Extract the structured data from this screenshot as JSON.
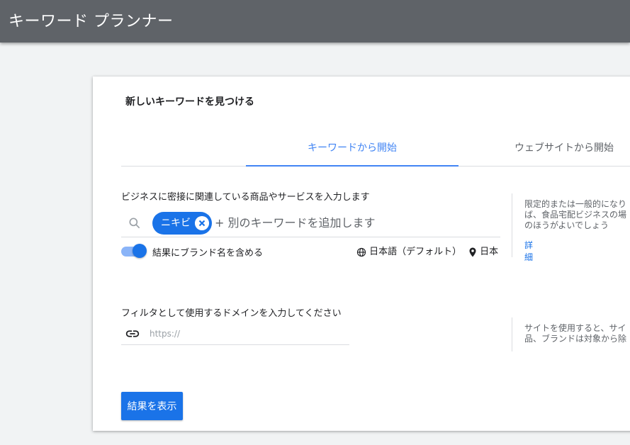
{
  "app": {
    "title": "キーワード プランナー"
  },
  "card": {
    "title": "新しいキーワードを見つける",
    "tabs": [
      {
        "label": "キーワードから開始",
        "active": true
      },
      {
        "label": "ウェブサイトから開始",
        "active": false
      }
    ],
    "keywords": {
      "label": "ビジネスに密接に関連している商品やサービスを入力します",
      "chip": "ニキビ",
      "placeholder": "+ 別のキーワードを追加します",
      "include_brand_label": "結果にブランド名を含める",
      "include_brand_enabled": true,
      "language": "日本語（デフォルト）",
      "location": "日本"
    },
    "hint1": {
      "lines": [
        "限定的または一般的になり",
        "ば、食品宅配ビジネスの場",
        "のほうがよいでしょう"
      ],
      "link": "詳細"
    },
    "domain": {
      "label": "フィルタとして使用するドメインを入力してください",
      "placeholder": "https://"
    },
    "hint2": {
      "lines": [
        "サイトを使用すると、サイ",
        "品、ブランドは対象から除"
      ]
    },
    "submit_label": "結果を表示"
  },
  "colors": {
    "accent": "#1a73e8",
    "topbar": "#5f6368",
    "background": "#f1f3f4"
  },
  "icons": [
    "search-icon",
    "chip-close-icon",
    "globe-icon",
    "location-pin-icon",
    "link-icon"
  ]
}
